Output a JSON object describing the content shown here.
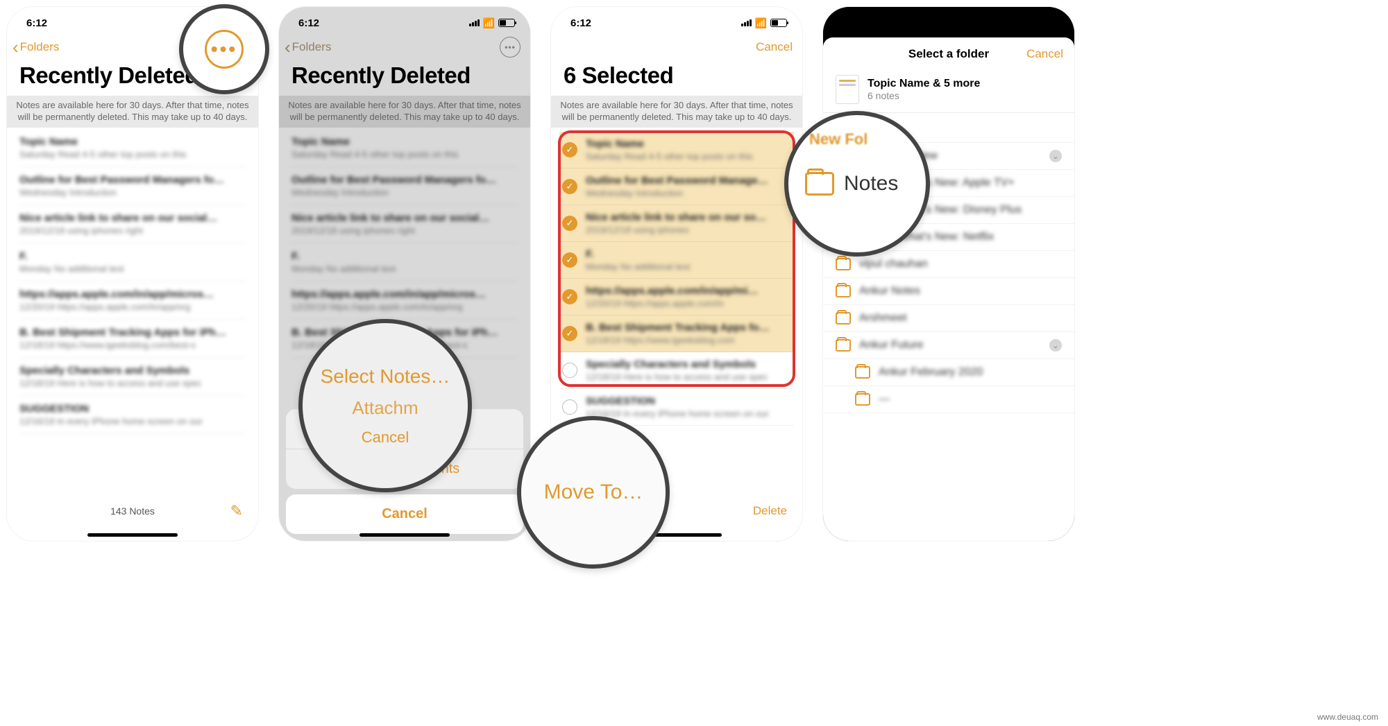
{
  "status": {
    "time": "6:12"
  },
  "accent": "#e2992d",
  "screen1": {
    "back": "Folders",
    "title": "Recently Deleted",
    "banner": "Notes are available here for 30 days. After that time, notes will be permanently deleted. This may take up to 40 days.",
    "footer_count": "143 Notes",
    "notes": [
      {
        "title": "Topic Name",
        "sub": "Saturday   Read 4-5 other top posts on this"
      },
      {
        "title": "Outline for Best Password Managers fo…",
        "sub": "Wednesday   Introduction"
      },
      {
        "title": "Nice article link to share on our social…",
        "sub": "2019/12/18 using iphones right"
      },
      {
        "title": "F.",
        "sub": "Monday   No additional text"
      },
      {
        "title": "https://apps.apple.com/in/app/micros…",
        "sub": "12/20/19   https://apps.apple.com/in/app/org"
      },
      {
        "title": "B. Best Shipment Tracking Apps for iPh…",
        "sub": "12/18/19   https://www.igeeksblog.com/best-s"
      },
      {
        "title": "Specially Characters and Symbols",
        "sub": "12/18/19   Here is how to access and use spec"
      },
      {
        "title": "SUGGESTION",
        "sub": "12/16/19   In every iPhone home screen on our"
      }
    ]
  },
  "screen2": {
    "back": "Folders",
    "title": "Recently Deleted",
    "banner": "Notes are available here for 30 days. After that time, notes will be permanently deleted. This may take up to 40 days.",
    "sheet": {
      "select_label": "Select Notes…",
      "attachments_label": "View Attachments",
      "cancel_label": "Cancel"
    }
  },
  "screen3": {
    "cancel": "Cancel",
    "title": "6 Selected",
    "banner": "Notes are available here for 30 days. After that time, notes will be permanently deleted. This may take up to 40 days.",
    "move_label": "Move To…",
    "delete_label": "Delete",
    "items": [
      {
        "title": "Topic Name",
        "sub": "Saturday   Read 4-5 other top posts on this",
        "checked": true
      },
      {
        "title": "Outline for Best Password Manage…",
        "sub": "Wednesday   Introduction",
        "checked": true
      },
      {
        "title": "Nice article link to share on our so…",
        "sub": "2019/12/18 using iphones",
        "checked": true
      },
      {
        "title": "F.",
        "sub": "Monday   No additional text",
        "checked": true
      },
      {
        "title": "https://apps.apple.com/in/app/mi…",
        "sub": "12/20/19   https://apps.apple.com/in",
        "checked": true
      },
      {
        "title": "B. Best Shipment Tracking Apps fo…",
        "sub": "12/18/19   https://www.igeeksblog.com",
        "checked": true
      },
      {
        "title": "Specially Characters and Symbols",
        "sub": "12/18/19   Here is how to access and use spec",
        "checked": false
      },
      {
        "title": "SUGGESTION",
        "sub": "12/16/19   In every iPhone home screen on our",
        "checked": false
      }
    ]
  },
  "screen4": {
    "modal_title": "Select a folder",
    "cancel": "Cancel",
    "header_title": "Topic Name & 5 more",
    "header_sub": "6 notes",
    "new_folder_hint": "New Folder",
    "folders": [
      {
        "label": "Notes",
        "indent": 0,
        "disclosure": false
      },
      {
        "label": "What's New",
        "indent": 1,
        "disclosure": true
      },
      {
        "label": "What's New: Apple TV+",
        "indent": 2,
        "disclosure": false
      },
      {
        "label": "What's New: Disney Plus",
        "indent": 2,
        "disclosure": false
      },
      {
        "label": "What's New: Netflix",
        "indent": 2,
        "disclosure": false
      },
      {
        "label": "vipul chauhan",
        "indent": 0,
        "disclosure": false
      },
      {
        "label": "Ankur Notes",
        "indent": 0,
        "disclosure": false
      },
      {
        "label": "Arshmeet",
        "indent": 0,
        "disclosure": false
      },
      {
        "label": "Ankur Future",
        "indent": 0,
        "disclosure": true
      },
      {
        "label": "Ankur February 2020",
        "indent": 1,
        "disclosure": false
      },
      {
        "label": "—",
        "indent": 1,
        "disclosure": false
      }
    ]
  },
  "callouts": {
    "c2_line1": "Select Notes…",
    "c2_line2": "Attachm",
    "c2_line3": "Cancel",
    "c3": "Move To…",
    "c4_nf": "New Fol",
    "c4_label": "Notes"
  },
  "watermark": "www.deuaq.com"
}
